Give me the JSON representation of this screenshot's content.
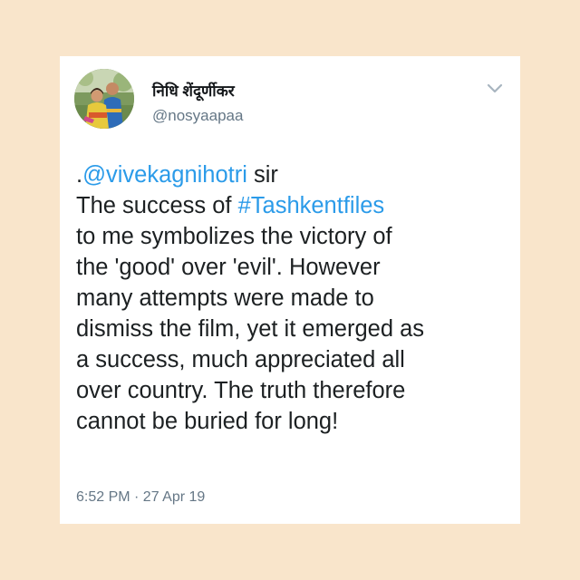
{
  "author": {
    "display_name": "निधि शेंदूर्णीकर",
    "handle": "@nosyaapaa",
    "avatar": "profile-photo"
  },
  "menu_icon": "chevron-down-icon",
  "tweet": {
    "mention_prefix": ".",
    "mention": "@vivekagnihotri",
    "after_mention": " sir",
    "line2_prefix": "The success of ",
    "hashtag": "#Tashkentfiles",
    "line3": "to me symbolizes the victory of",
    "line4": "the 'good' over 'evil'. However",
    "line5": "many attempts were made to",
    "line6": "dismiss the film, yet it emerged as",
    "line7": "a success, much appreciated all",
    "line8": "over country. The truth therefore",
    "line9": "cannot be buried for long!"
  },
  "timestamp": "6:52 PM · 27 Apr 19",
  "colors": {
    "background": "#f9e5cb",
    "card": "#ffffff",
    "link": "#2b9be9",
    "secondary_text": "#657786",
    "primary_text": "#1c2022"
  }
}
